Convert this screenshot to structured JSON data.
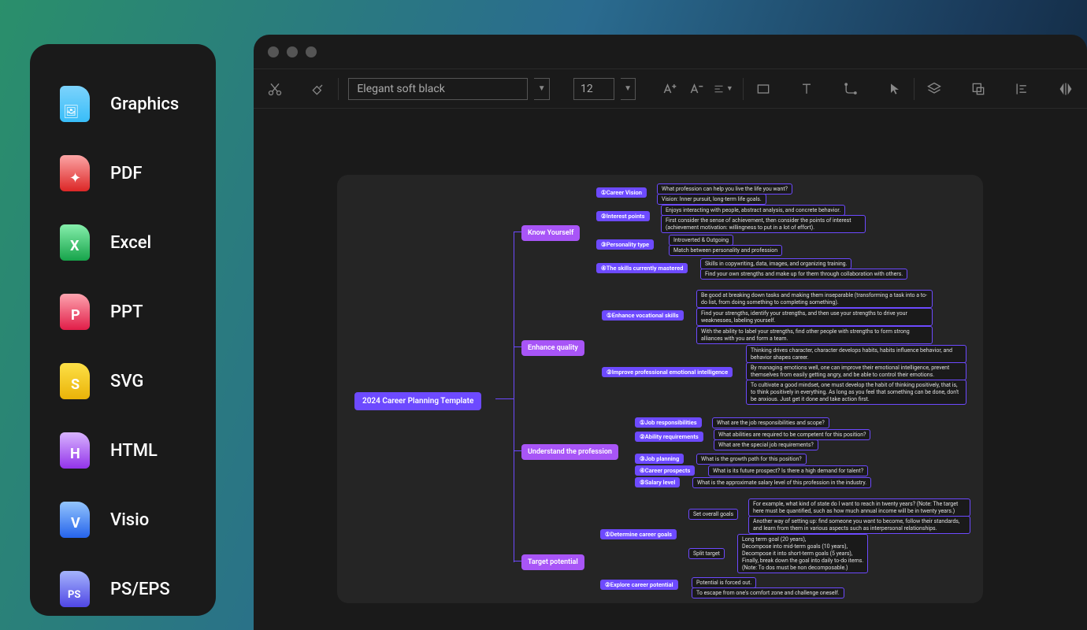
{
  "sidebar": {
    "items": [
      {
        "label": "Graphics",
        "icon": "graphics"
      },
      {
        "label": "PDF",
        "icon": "pdf"
      },
      {
        "label": "Excel",
        "icon": "excel"
      },
      {
        "label": "PPT",
        "icon": "ppt"
      },
      {
        "label": "SVG",
        "icon": "svg"
      },
      {
        "label": "HTML",
        "icon": "html"
      },
      {
        "label": "Visio",
        "icon": "visio"
      },
      {
        "label": "PS/EPS",
        "icon": "ps"
      }
    ]
  },
  "toolbar": {
    "theme": "Elegant soft black",
    "font_size": "12"
  },
  "mindmap": {
    "root": "2024 Career Planning Template",
    "branches": [
      {
        "label": "Know Yourself",
        "subs": [
          {
            "label": "①Career Vision",
            "leaves": [
              "What profession can help you live the life you want?",
              "Vision: Inner pursuit, long-term life goals."
            ]
          },
          {
            "label": "②Interest points",
            "leaves": [
              "Enjoys interacting with people, abstract analysis, and concrete behavior.",
              "First consider the sense of achievement, then consider the points of interest (achievement motivation: willingness to put in a lot of effort)."
            ]
          },
          {
            "label": "③Personality type",
            "leaves": [
              "Introverted & Outgoing",
              "Match between personality and profession"
            ]
          },
          {
            "label": "④The skills currently mastered",
            "leaves": [
              "Skills in copywriting, data, images, and organizing training.",
              "Find your own strengths and make up for them through collaboration with others."
            ]
          }
        ]
      },
      {
        "label": "Enhance quality",
        "subs": [
          {
            "label": "①Enhance vocational skills",
            "leaves": [
              "Be good at breaking down tasks and making them inseparable (transforming a task into a to-do list, from doing something to completing something).",
              "Find your strengths, identify your strengths, and then use your strengths to drive your weaknesses, labeling yourself.",
              "With the ability to label your strengths, find other people with strengths to form strong alliances with you and form a team."
            ]
          },
          {
            "label": "②Improve professional emotional intelligence",
            "leaves": [
              "Thinking drives character, character develops habits, habits influence behavior, and behavior shapes career.",
              "By managing emotions well, one can improve their emotional intelligence, prevent themselves from easily getting angry, and be able to control their emotions.",
              "To cultivate a good mindset, one must develop the habit of thinking positively, that is, to think positively in everything. As long as you feel that something can be done, don't be anxious. Just get it done and take action first."
            ]
          }
        ]
      },
      {
        "label": "Understand the profession",
        "subs": [
          {
            "label": "①Job responsibilities",
            "leaves": [
              "What are the job responsibilities and scope?"
            ]
          },
          {
            "label": "②Ability requirements",
            "leaves": [
              "What abilities are required to be competent for this position?",
              "What are the special job requirements?"
            ]
          },
          {
            "label": "③Job planning",
            "leaves": [
              "What is the growth path for this position?"
            ]
          },
          {
            "label": "④Career prospects",
            "leaves": [
              "What is its future prospect? Is there a high demand for talent?"
            ]
          },
          {
            "label": "⑤Salary level",
            "leaves": [
              "What is the approximate salary level of this profession in the industry."
            ]
          }
        ]
      },
      {
        "label": "Target potential",
        "subs": [
          {
            "label": "①Determine career goals",
            "leaves_groups": [
              {
                "group": "Set overall goals",
                "leaves": [
                  "For example, what kind of state do I want to reach in twenty years? (Note: The target here must be quantified, such as how much annual income will be in twenty years.)",
                  "Another way of setting up: find someone you want to become, follow their standards, and learn from them in various aspects such as interpersonal relationships."
                ]
              },
              {
                "group": "Split target",
                "leaves": [
                  "Long term goal (20 years),\nDecompose into mid-term goals (10 years),\nDecompose it into short-term goals (5 years),\nFinally, break down the goal into daily to-do items.\n(Note: To dos must be non decomposable.)"
                ]
              }
            ]
          },
          {
            "label": "②Explore career potential",
            "leaves": [
              "Potential is forced out.",
              "To escape from one's comfort zone and challenge oneself."
            ]
          }
        ]
      }
    ]
  }
}
